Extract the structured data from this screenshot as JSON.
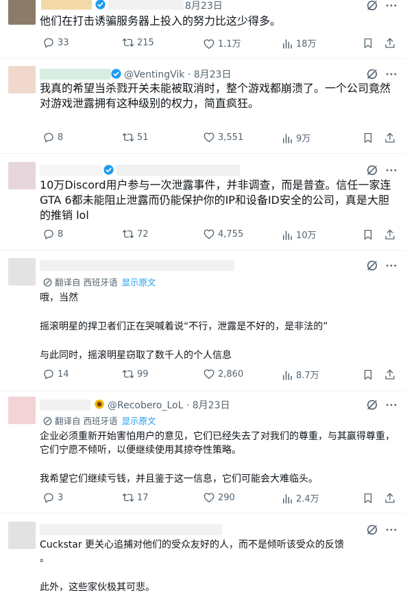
{
  "colors": {
    "text": "#0f1419",
    "secondary": "#536471",
    "accent": "#1d9bf0",
    "divider": "#eff3f4",
    "verified": "#1d9bf0"
  },
  "icons": [
    "grok-icon",
    "more-icon",
    "reply-icon",
    "retweet-icon",
    "like-icon",
    "views-icon",
    "bookmark-icon",
    "share-icon",
    "translate-icon",
    "verified-badge-icon",
    "sunflower-icon"
  ],
  "tweets": [
    {
      "date": "8月23日",
      "handle": "",
      "text": [
        "他们在打击诱骗服务器上投入的努力比这少得多。"
      ],
      "replies": "33",
      "retweets": "215",
      "likes": "1.1万",
      "views": "18万"
    },
    {
      "handle": "@VentingVik · 8月23日",
      "text": [
        "我真的希望当杀戮开关未能被取消时，整个游戏都崩溃了。一个公司竟然对游戏泄露拥有这种级别的权力，简直疯狂。"
      ],
      "replies": "8",
      "retweets": "51",
      "likes": "3,551",
      "views": "9万"
    },
    {
      "handle": "",
      "text": [
        "10万Discord用户参与一次泄露事件，并非调查，而是普查。信任一家连GTA 6都未能阻止泄露而仍能保护你的IP和设备ID安全的公司，真是大胆的推销 lol"
      ],
      "replies": "8",
      "retweets": "72",
      "likes": "4,755",
      "views": "10万"
    },
    {
      "handle": "",
      "translated_from": "翻译自 西班牙语",
      "show_original": "显示原文",
      "text": [
        "哦，当然",
        "摇滚明星的捍卫者们正在哭喊着说“不行，泄露是不好的，是非法的”",
        "与此同时，摇滚明星窃取了数千人的个人信息"
      ],
      "replies": "14",
      "retweets": "99",
      "likes": "2,860",
      "views": "8.7万"
    },
    {
      "handle": "@Recobero_LoL · 8月23日",
      "translated_from": "翻译自 西班牙语",
      "show_original": "显示原文",
      "text": [
        "企业必须重新开始害怕用户的意见，它们已经失去了对我们的尊重，与其赢得尊重，它们宁愿不倾听，以便继续使用其掠夺性策略。",
        "我希望它们继续亏钱，并且鉴于这一信息，它们可能会大难临头。"
      ],
      "replies": "3",
      "retweets": "17",
      "likes": "290",
      "views": "2.4万"
    },
    {
      "handle": "",
      "text": [
        "Cuckstar 更关心追捕对他们的受众友好的人，而不是倾听该受众的反馈",
        "。",
        "此外，这些家伙极其可悲。"
      ]
    }
  ]
}
